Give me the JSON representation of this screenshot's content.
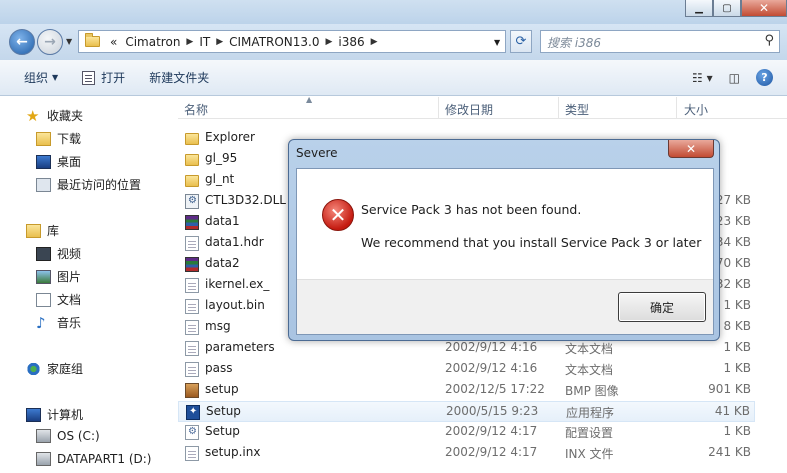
{
  "window": {
    "title": "Severe"
  },
  "address": {
    "crumbs": [
      "«",
      "Cimatron",
      "IT",
      "CIMATRON13.0",
      "i386"
    ],
    "search_placeholder": "搜索 i386"
  },
  "toolbar": {
    "organize": "组织",
    "open": "打开",
    "new_folder": "新建文件夹"
  },
  "sidebar": {
    "favorites": "收藏夹",
    "downloads": "下载",
    "desktop": "桌面",
    "recent": "最近访问的位置",
    "libraries": "库",
    "videos": "视频",
    "pictures": "图片",
    "documents": "文档",
    "music": "音乐",
    "homegroup": "家庭组",
    "computer": "计算机",
    "drive_c": "OS (C:)",
    "drive_d": "DATAPART1 (D:)"
  },
  "columns": {
    "name": "名称",
    "date": "修改日期",
    "type": "类型",
    "size": "大小"
  },
  "files": [
    {
      "name": "Explorer",
      "date": "",
      "type": "",
      "size": "",
      "icon": "folder"
    },
    {
      "name": "gl_95",
      "date": "",
      "type": "",
      "size": "",
      "icon": "folder"
    },
    {
      "name": "gl_nt",
      "date": "",
      "type": "",
      "size": "",
      "icon": "folder"
    },
    {
      "name": "CTL3D32.DLL",
      "date": "",
      "type": "",
      "size": "27 KB",
      "icon": "dll"
    },
    {
      "name": "data1",
      "date": "",
      "type": "",
      "size": "23 KB",
      "icon": "rar"
    },
    {
      "name": "data1.hdr",
      "date": "",
      "type": "",
      "size": "34 KB",
      "icon": "doc"
    },
    {
      "name": "data2",
      "date": "",
      "type": "",
      "size": "70 KB",
      "icon": "rar"
    },
    {
      "name": "ikernel.ex_",
      "date": "",
      "type": "",
      "size": "32 KB",
      "icon": "doc"
    },
    {
      "name": "layout.bin",
      "date": "",
      "type": "",
      "size": "1 KB",
      "icon": "doc"
    },
    {
      "name": "msg",
      "date": "",
      "type": "",
      "size": "8 KB",
      "icon": "doc"
    },
    {
      "name": "parameters",
      "date": "2002/9/12 4:16",
      "type": "文本文档",
      "size": "1 KB",
      "icon": "doc"
    },
    {
      "name": "pass",
      "date": "2002/9/12 4:16",
      "type": "文本文档",
      "size": "1 KB",
      "icon": "doc"
    },
    {
      "name": "setup",
      "date": "2002/12/5 17:22",
      "type": "BMP 图像",
      "size": "901 KB",
      "icon": "bmp"
    },
    {
      "name": "Setup",
      "date": "2000/5/15 9:23",
      "type": "应用程序",
      "size": "41 KB",
      "icon": "exe"
    },
    {
      "name": "Setup",
      "date": "2002/9/12 4:17",
      "type": "配置设置",
      "size": "1 KB",
      "icon": "ini"
    },
    {
      "name": "setup.inx",
      "date": "2002/9/12 4:17",
      "type": "INX 文件",
      "size": "241 KB",
      "icon": "doc"
    }
  ],
  "dialog": {
    "title": "Severe",
    "close": "✕",
    "message": "Service Pack 3 has not been found.",
    "detail": "We recommend that you install Service Pack 3 or later",
    "ok": "确定"
  }
}
